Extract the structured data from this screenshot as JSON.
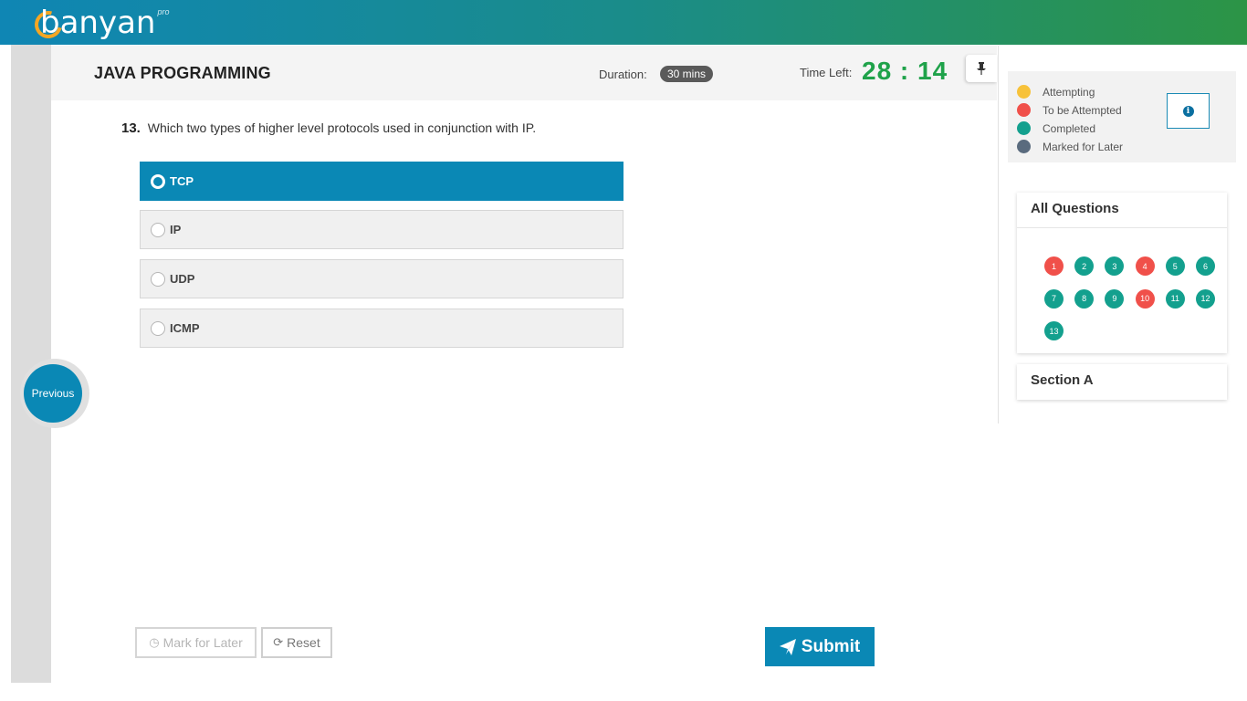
{
  "brand": {
    "name": "banyan",
    "suffix": "pro"
  },
  "exam": {
    "title": "JAVA PROGRAMMING",
    "duration_label": "Duration:",
    "duration_value": "30 mins",
    "time_left_label": "Time Left:",
    "time_left_value": "28 : 14"
  },
  "question": {
    "number": "13.",
    "text": "Which two types of higher level protocols used in conjunction with IP.",
    "options": [
      {
        "label": "TCP",
        "selected": true
      },
      {
        "label": "IP",
        "selected": false
      },
      {
        "label": "UDP",
        "selected": false
      },
      {
        "label": "ICMP",
        "selected": false
      }
    ]
  },
  "nav": {
    "previous_label": "Previous"
  },
  "actions": {
    "mark_later_label": "Mark for Later",
    "reset_label": "Reset",
    "submit_label": "Submit"
  },
  "legend": [
    {
      "label": "Attempting",
      "color": "#f7c23a"
    },
    {
      "label": "To be Attempted",
      "color": "#f0504a"
    },
    {
      "label": "Completed",
      "color": "#13a08e"
    },
    {
      "label": "Marked for Later",
      "color": "#5a6b7e"
    }
  ],
  "all_questions": {
    "title": "All Questions",
    "items": [
      {
        "n": "1",
        "status": "to_be_attempted"
      },
      {
        "n": "2",
        "status": "completed"
      },
      {
        "n": "3",
        "status": "completed"
      },
      {
        "n": "4",
        "status": "to_be_attempted"
      },
      {
        "n": "5",
        "status": "completed"
      },
      {
        "n": "6",
        "status": "completed"
      },
      {
        "n": "7",
        "status": "completed"
      },
      {
        "n": "8",
        "status": "completed"
      },
      {
        "n": "9",
        "status": "completed"
      },
      {
        "n": "10",
        "status": "to_be_attempted"
      },
      {
        "n": "11",
        "status": "completed"
      },
      {
        "n": "12",
        "status": "completed"
      },
      {
        "n": "13",
        "status": "completed"
      }
    ]
  },
  "section": {
    "title": "Section A"
  },
  "colors": {
    "accent": "#0a88b5",
    "timer": "#1fa24a",
    "completed": "#13a08e",
    "to_be_attempted": "#f0504a"
  },
  "icons": {
    "pin": "pin-icon",
    "info": "info-icon",
    "clock": "clock-icon",
    "reset": "refresh-icon",
    "submit": "paper-plane-icon"
  }
}
